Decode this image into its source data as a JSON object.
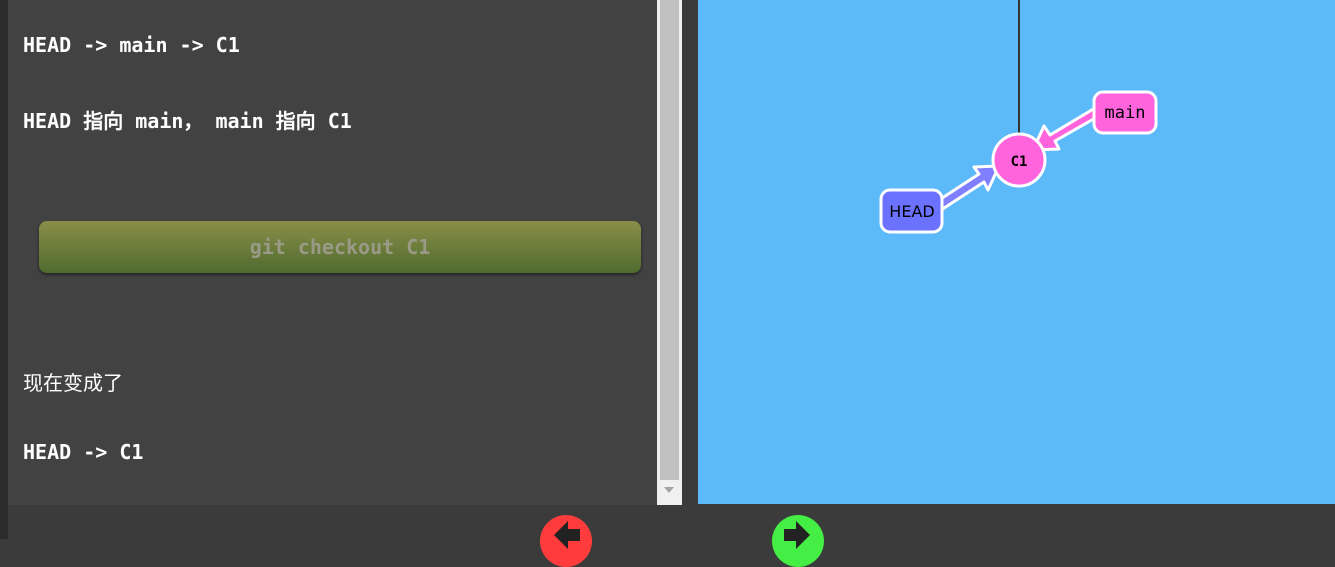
{
  "tutorial": {
    "line1": "HEAD -> main -> C1",
    "line2": "HEAD 指向 main， main 指向 C1",
    "command": "git checkout C1",
    "line3": "现在变成了",
    "line4": "HEAD -> C1"
  },
  "graph": {
    "commit_label": "C1",
    "branch_label": "main",
    "head_label": "HEAD",
    "colors": {
      "canvas": "#5cbaf9",
      "commit": "#ff64dc",
      "branch": "#ff64dc",
      "head": "#6a72ff"
    }
  },
  "navigation": {
    "prev_icon": "back-arrow-icon",
    "next_icon": "forward-arrow-icon"
  }
}
